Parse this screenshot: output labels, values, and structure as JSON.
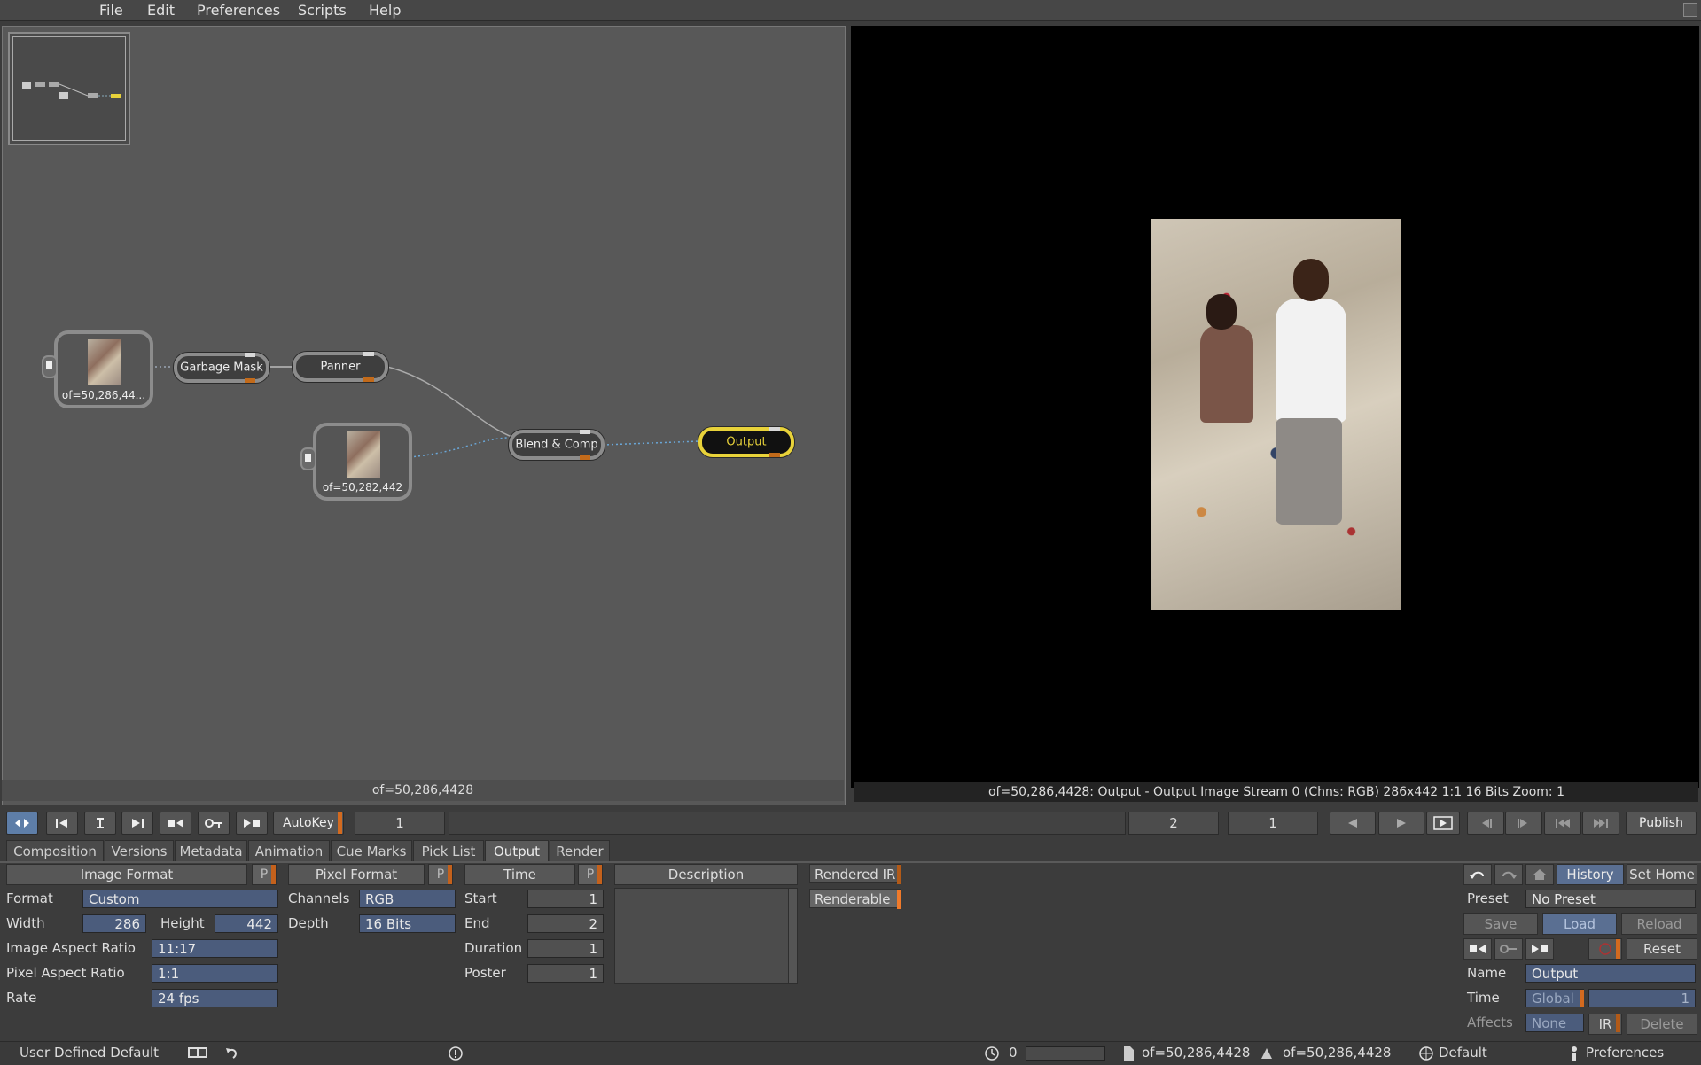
{
  "menu": [
    "File",
    "Edit",
    "Preferences",
    "Scripts",
    "Help"
  ],
  "nodes": {
    "read1_caption": "of=50,286,44...",
    "read2_caption": "of=50,282,442",
    "garbage_mask": "Garbage Mask",
    "panner": "Panner",
    "blend_comp": "Blend & Comp",
    "output": "Output"
  },
  "nodegraph_footer": "of=50,286,4428",
  "viewer_status": "of=50,286,4428: Output - Output Image  Stream 0 (Chns: RGB)  286x442  1:1  16 Bits  Zoom: 1",
  "transport": {
    "autokey": "AutoKey",
    "current_frame": "1",
    "end_field": "2",
    "start_field": "1",
    "publish": "Publish"
  },
  "tabs": [
    "Composition",
    "Versions",
    "Metadata",
    "Animation",
    "Cue Marks",
    "Pick List",
    "Output",
    "Render"
  ],
  "active_tab": "Output",
  "image_format": {
    "header": "Image Format",
    "p": "P",
    "format_label": "Format",
    "format_value": "Custom",
    "width_label": "Width",
    "width_value": "286",
    "height_label": "Height",
    "height_value": "442",
    "iar_label": "Image Aspect Ratio",
    "iar_value": "11:17",
    "par_label": "Pixel Aspect Ratio",
    "par_value": "1:1",
    "rate_label": "Rate",
    "rate_value": "24 fps"
  },
  "pixel_format": {
    "header": "Pixel Format",
    "p": "P",
    "channels_label": "Channels",
    "channels_value": "RGB",
    "depth_label": "Depth",
    "depth_value": "16 Bits"
  },
  "time": {
    "header": "Time",
    "p": "P",
    "start_label": "Start",
    "start_value": "1",
    "end_label": "End",
    "end_value": "2",
    "duration_label": "Duration",
    "duration_value": "1",
    "poster_label": "Poster",
    "poster_value": "1"
  },
  "description": {
    "header": "Description"
  },
  "flags": {
    "rendered_ir": "Rendered IR",
    "renderable": "Renderable"
  },
  "right_panel": {
    "history": "History",
    "set_home": "Set Home",
    "preset_label": "Preset",
    "preset_value": "No Preset",
    "save": "Save",
    "load": "Load",
    "reload": "Reload",
    "reset": "Reset",
    "name_label": "Name",
    "name_value": "Output",
    "time_label": "Time",
    "time_mode": "Global",
    "time_value": "1",
    "affects_label": "Affects",
    "affects_value": "None",
    "ir": "IR",
    "delete": "Delete"
  },
  "statusbar": {
    "preset": "User Defined Default",
    "clock_value": "0",
    "file1": "of=50,286,4428",
    "file2": "of=50,286,4428",
    "layout": "Default",
    "preferences": "Preferences"
  },
  "colors": {
    "accent_orange": "#d36a1f",
    "field_blue": "#4b5c7c",
    "output_yellow": "#e8d23a"
  }
}
